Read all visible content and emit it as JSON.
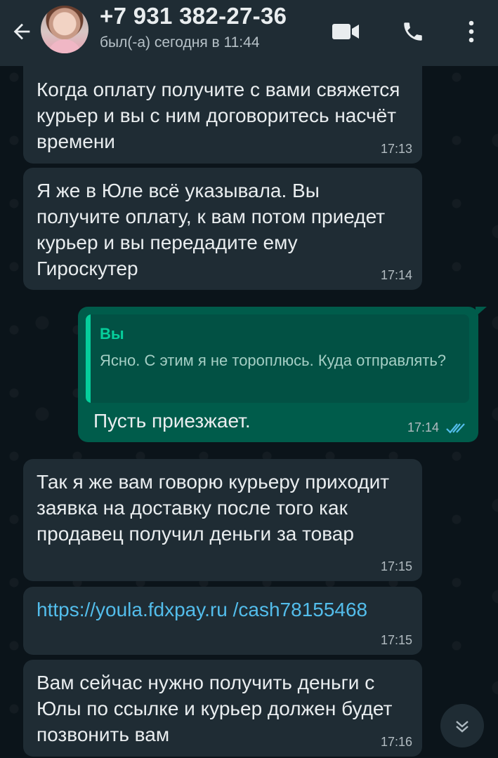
{
  "header": {
    "back_icon": "arrow-left-icon",
    "contact_name": "+7 931 382-27-36",
    "status": "был(-а) сегодня в 11:44",
    "video_icon": "video-camera-icon",
    "call_icon": "phone-icon",
    "menu_icon": "more-vertical-icon"
  },
  "messages": [
    {
      "direction": "in",
      "text": "Когда оплату получите с вами свяжется курьер и вы с ним договоритесь насчёт времени",
      "time": "17:13"
    },
    {
      "direction": "in",
      "text": "Я же в Юле всё указывала. Вы получите оплату, к вам потом приедет курьер и вы передадите ему Гироскутер",
      "time": "17:14"
    },
    {
      "direction": "out",
      "quote_author": "Вы",
      "quote_text": "Ясно. С этим я не тороплюсь. Куда отправлять?",
      "text": "Пусть приезжает.",
      "time": "17:14",
      "status_icon": "double-check-read-icon"
    },
    {
      "direction": "in",
      "text": "Так я же вам говорю курьеру приходит заявка на доставку после того как продавец получил деньги за товар",
      "time": "17:15"
    },
    {
      "direction": "in",
      "link": "https://youla.fdxpay.ru /cash78155468",
      "time": "17:15"
    },
    {
      "direction": "in",
      "text": "Вам сейчас нужно получить деньги с Юлы по ссылке и курьер должен будет позвонить вам",
      "time": "17:16"
    }
  ],
  "scroll_button_icon": "chevron-double-down-icon",
  "colors": {
    "background": "#0b141a",
    "header": "#1f2c34",
    "incoming_bubble": "#1f2c34",
    "outgoing_bubble": "#005c4b",
    "accent": "#06cf9c",
    "link": "#53bdeb",
    "read_ticks": "#53bdeb"
  }
}
